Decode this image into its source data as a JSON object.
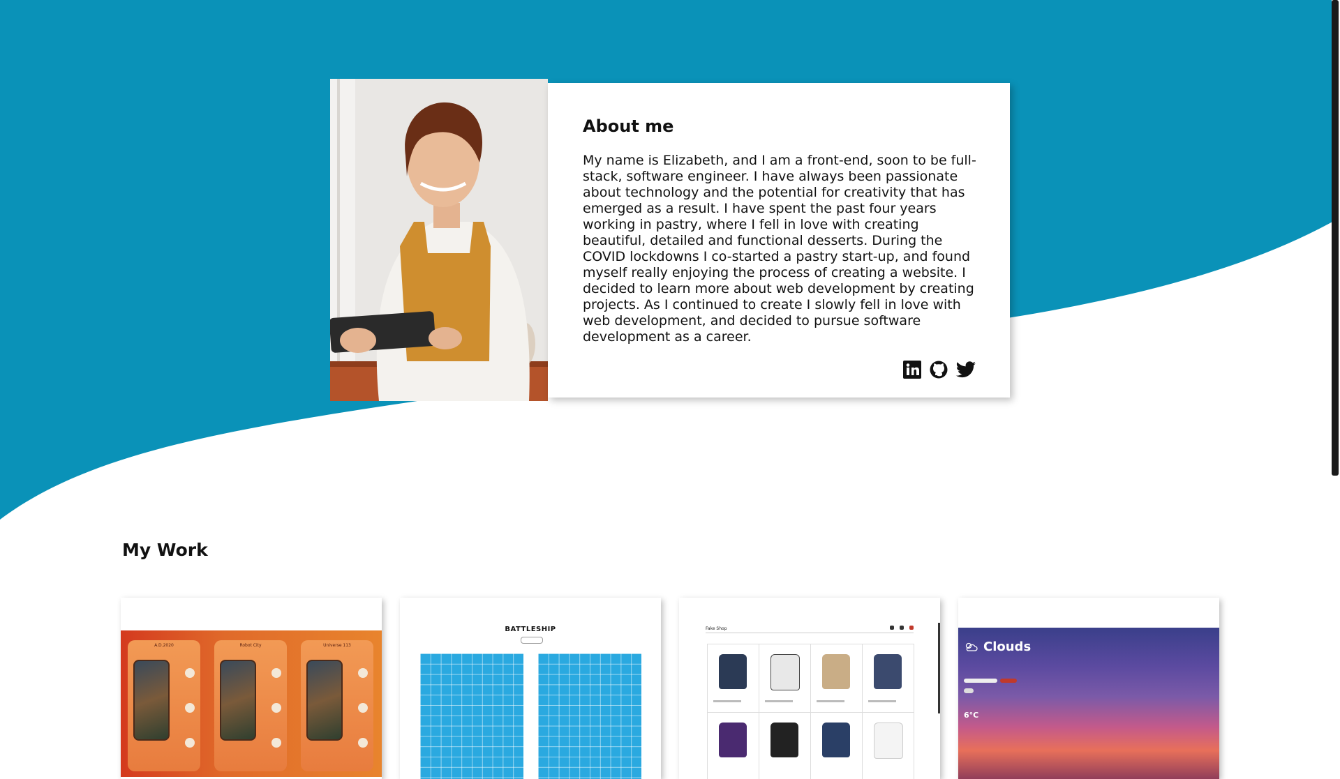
{
  "colors": {
    "primary_wave": "#0a92b8",
    "card_bg": "#ffffff",
    "text": "#111111"
  },
  "about": {
    "title": "About me",
    "text": "My name is Elizabeth, and I am a front-end, soon to be full-stack, software engineer. I have always been passionate about technology and the potential for creativity that has emerged as a result. I have spent the past four years working in pastry, where I fell in love with creating beautiful, detailed and functional desserts. During the COVID lockdowns I co-started a pastry start-up, and found myself really enjoying the process of creating a website. I decided to learn more about web development by creating projects. As I continued to create I slowly fell in love with web development, and decided to pursue software development as a career.",
    "photo_icon": "portrait-photo",
    "socials": [
      {
        "name": "linkedin",
        "icon": "linkedin-icon"
      },
      {
        "name": "github",
        "icon": "github-icon"
      },
      {
        "name": "twitter",
        "icon": "twitter-icon"
      }
    ]
  },
  "work": {
    "title": "My Work",
    "projects": [
      {
        "id": "p1",
        "labels": [
          "A.D.2020",
          "Robot City",
          "Universe 113"
        ]
      },
      {
        "id": "p2",
        "title": "BATTLESHIP"
      },
      {
        "id": "p3",
        "header": "Fake Shop"
      },
      {
        "id": "p4",
        "title": "Clouds",
        "temp": "6°C"
      }
    ]
  }
}
